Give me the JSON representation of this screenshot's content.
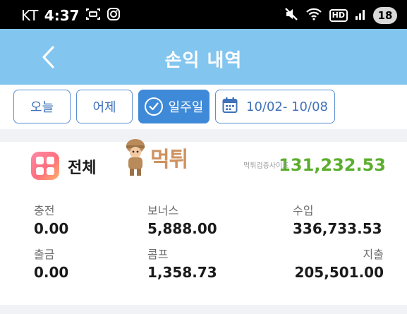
{
  "status_bar": {
    "carrier": "KT",
    "time": "4:37",
    "hd_label": "HD",
    "battery": "18"
  },
  "header": {
    "title": "손익 내역"
  },
  "filters": {
    "today": "오늘",
    "yesterday": "어제",
    "week": "일주일",
    "date_range": "10/02- 10/08",
    "selected": "week",
    "accent_color": "#3f8ad8"
  },
  "summary": {
    "total_label": "전체",
    "total_value": "131,232.53",
    "total_color": "#5cae2e"
  },
  "watermark": {
    "text": "먹튀",
    "subtext": "먹튀검증사이트"
  },
  "stats": {
    "deposit": {
      "label": "충전",
      "value": "0.00"
    },
    "bonus": {
      "label": "보너스",
      "value": "5,888.00"
    },
    "income": {
      "label": "수입",
      "value": "336,733.53"
    },
    "withdraw": {
      "label": "출금",
      "value": "0.00"
    },
    "comp": {
      "label": "콤프",
      "value": "1,358.73"
    },
    "expense": {
      "label": "지출",
      "value": "205,501.00"
    }
  }
}
